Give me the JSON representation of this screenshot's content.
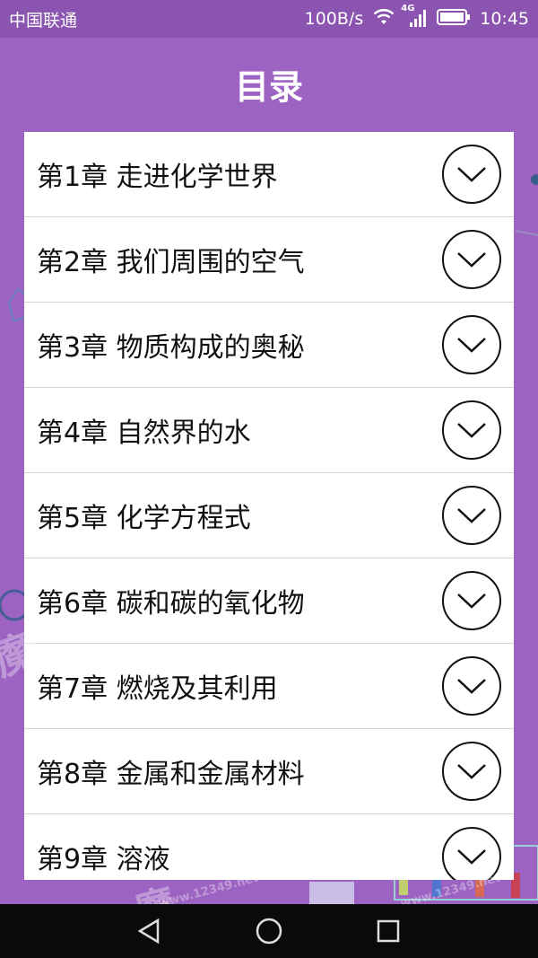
{
  "status_bar": {
    "carrier": "中国联通",
    "network_speed": "100B/s",
    "network_type": "4G",
    "time": "10:45"
  },
  "header": {
    "title": "目录"
  },
  "chapters": [
    {
      "label": "第1章 走进化学世界"
    },
    {
      "label": "第2章 我们周围的空气"
    },
    {
      "label": "第3章 物质构成的奥秘"
    },
    {
      "label": "第4章 自然界的水"
    },
    {
      "label": "第5章 化学方程式"
    },
    {
      "label": "第6章 碳和碳的氧化物"
    },
    {
      "label": "第7章 燃烧及其利用"
    },
    {
      "label": "第8章 金属和金属材料"
    },
    {
      "label": "第9章 溶液"
    }
  ],
  "watermark": {
    "text": "魔",
    "url": "www.12349.net"
  },
  "colors": {
    "background": "#9d63c2",
    "status_bar": "#8a54b0",
    "list_background": "#ffffff",
    "nav_bar": "#0a0a0a"
  },
  "icons": {
    "expand": "chevron-down-circle-icon",
    "nav_back": "back-triangle-icon",
    "nav_home": "home-circle-icon",
    "nav_recent": "recent-square-icon",
    "wifi": "wifi-icon",
    "signal": "signal-icon",
    "battery": "battery-icon"
  }
}
